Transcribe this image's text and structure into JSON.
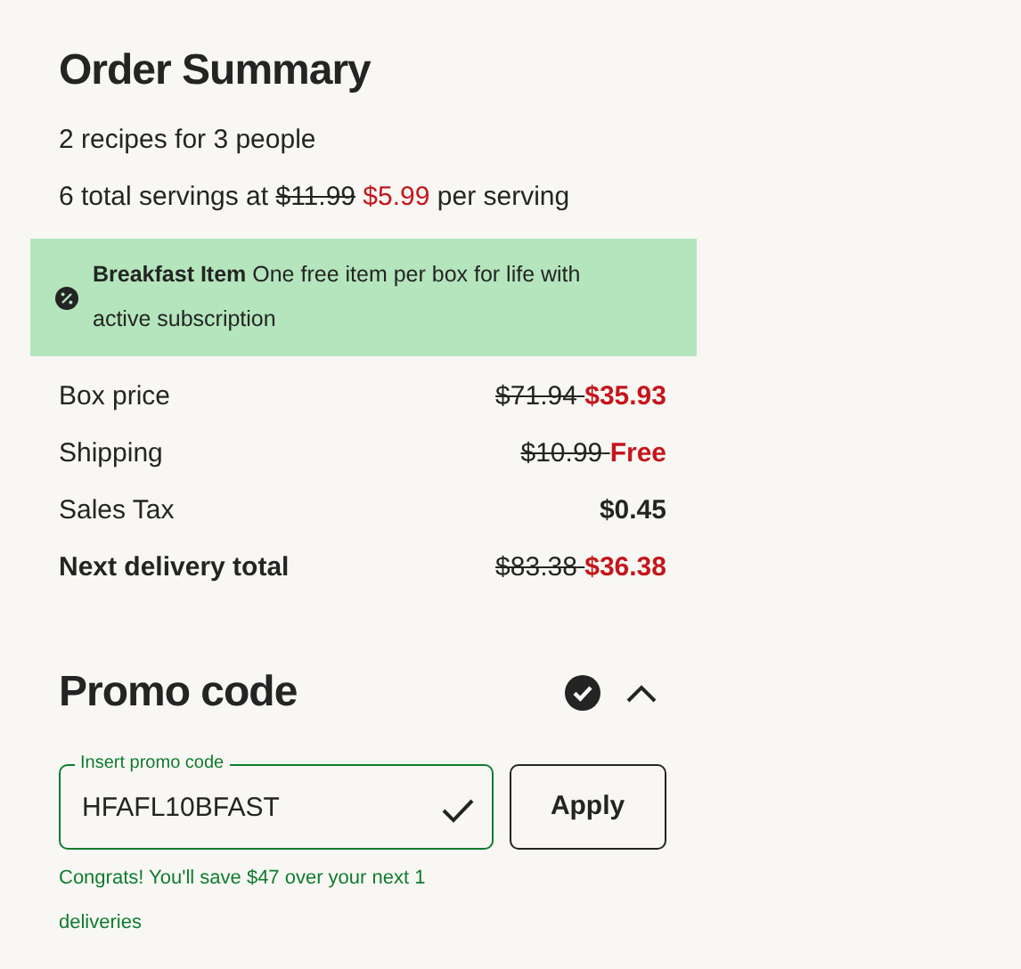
{
  "summary": {
    "title": "Order Summary",
    "recipes_line": "2 recipes for 3 people",
    "servings_line": {
      "prefix": "6 total servings at",
      "old_price": "$11.99",
      "price": "$5.99",
      "suffix": "per serving"
    }
  },
  "promo_banner": {
    "text": "**Breakfast Item** One free item per box for life with active subscription"
  },
  "price_rows": [
    {
      "label": "Box price",
      "old_price": "$71.94",
      "price": "$35.93",
      "highlight": true,
      "emphasis": false
    },
    {
      "label": "Shipping",
      "old_price": "$10.99",
      "price": "Free",
      "highlight": true,
      "emphasis": false
    },
    {
      "label": "Sales Tax",
      "price": "$0.45",
      "highlight": false,
      "emphasis": false
    },
    {
      "label": "Next delivery total",
      "old_price": "$83.38",
      "price": "$36.38",
      "highlight": true,
      "emphasis": true
    }
  ],
  "promo_code": {
    "title": "Promo code",
    "applied": true,
    "expanded": true,
    "field_label": "Insert promo code",
    "value": "HFAFL10BFAST",
    "valid": true,
    "button": "Apply",
    "message": "Congrats! You'll save $47 over your next 1 deliveries"
  }
}
